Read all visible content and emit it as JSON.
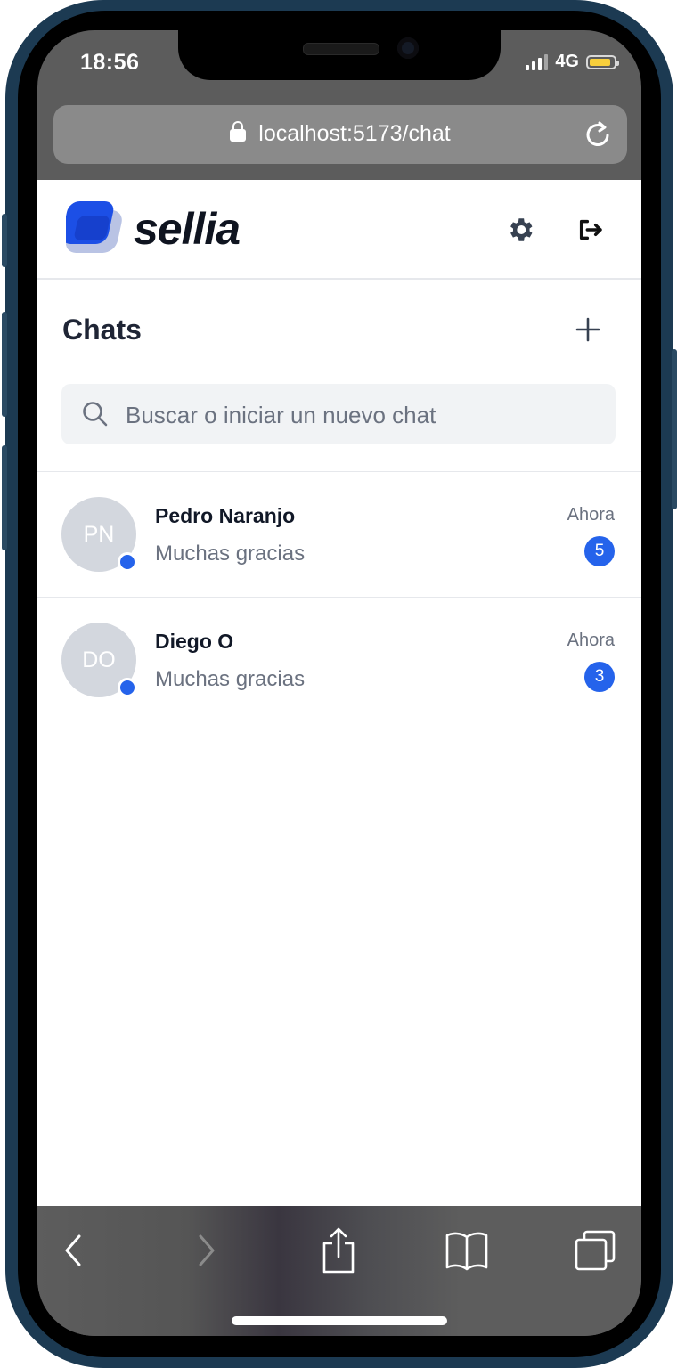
{
  "status_bar": {
    "time": "18:56",
    "network": "4G"
  },
  "browser": {
    "url": "localhost:5173/chat"
  },
  "header": {
    "logo_text": "sellia"
  },
  "chats": {
    "title": "Chats",
    "search_placeholder": "Buscar o iniciar un nuevo chat",
    "items": [
      {
        "initials": "PN",
        "name": "Pedro Naranjo",
        "preview": "Muchas gracias",
        "time": "Ahora",
        "unread": "5"
      },
      {
        "initials": "DO",
        "name": "Diego O",
        "preview": "Muchas gracias",
        "time": "Ahora",
        "unread": "3"
      }
    ]
  },
  "colors": {
    "accent": "#2563eb",
    "avatar_bg": "#d3d7de",
    "text_primary": "#111827",
    "text_muted": "#6b7280"
  },
  "icons": [
    "lock-icon",
    "reload-icon",
    "settings-icon",
    "logout-icon",
    "plus-icon",
    "search-icon",
    "back-icon",
    "forward-icon",
    "share-icon",
    "bookmarks-icon",
    "tabs-icon"
  ]
}
